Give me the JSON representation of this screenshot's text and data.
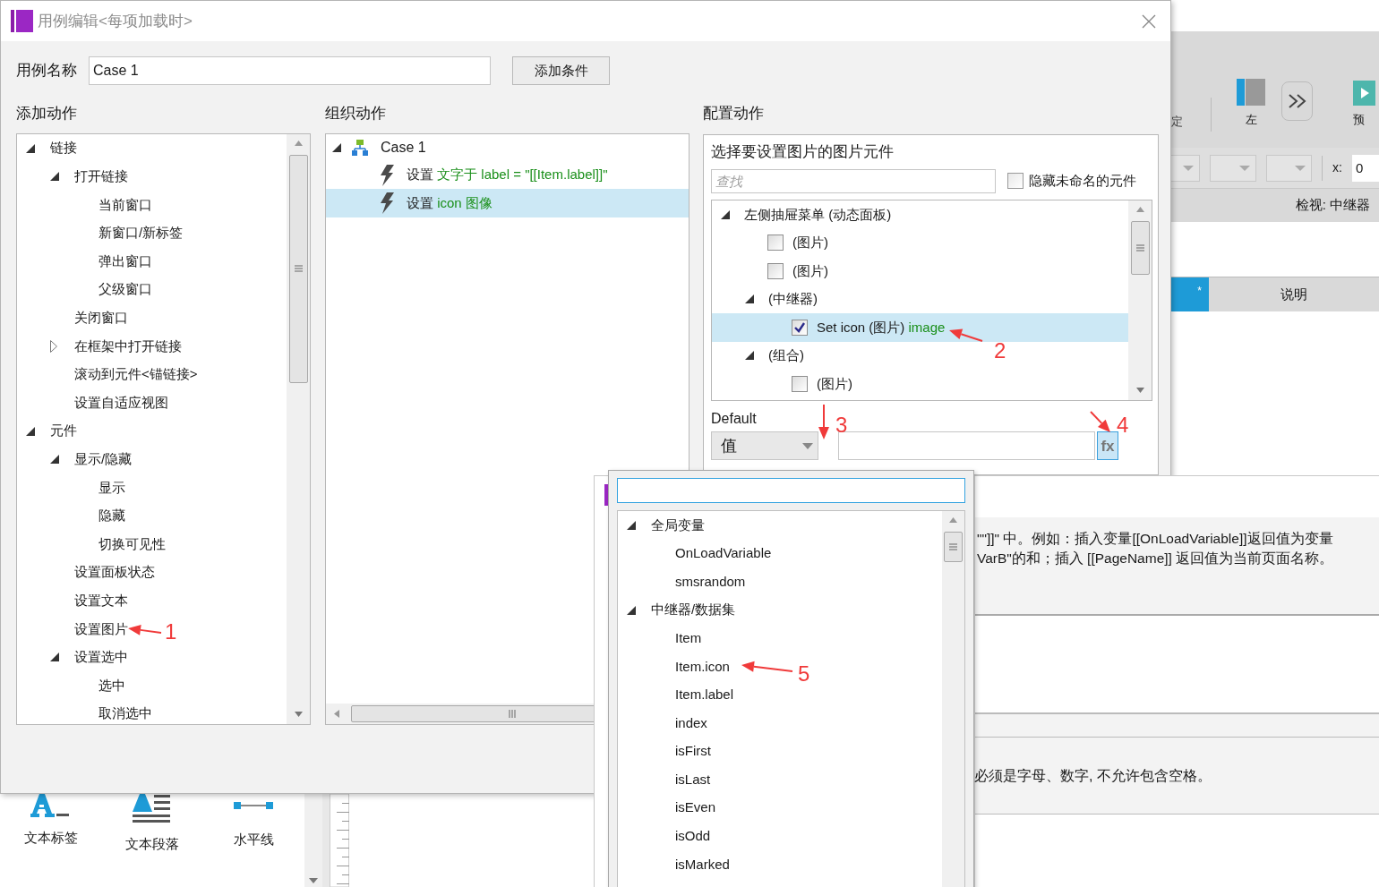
{
  "background": {
    "toolbar": {
      "items": [
        {
          "kind": "cut",
          "label": "定"
        },
        {
          "kind": "panel-left",
          "label": "左"
        },
        {
          "kind": "more"
        },
        {
          "kind": "preview",
          "label": "预"
        }
      ],
      "x_label": "x:",
      "x_value": "0"
    },
    "inspect_title": "检视: 中继器",
    "tabs": [
      {
        "label": "*",
        "selected": true
      },
      {
        "label": "说明",
        "selected": false
      }
    ],
    "help_lines": [
      "\"\"]]\" 中。例如：插入变量[[OnLoadVariable]]返回值为变量",
      "VarB\"的和；插入 [[PageName]] 返回值为当前页面名称。"
    ],
    "rule_text": "必须是字母、数字, 不允许包含空格。",
    "widgets": [
      {
        "kind": "label",
        "label": "文本标签"
      },
      {
        "kind": "paragraph",
        "label": "文本段落"
      },
      {
        "kind": "hline",
        "label": "水平线"
      }
    ]
  },
  "dialog": {
    "title": "用例编辑<每项加载时>",
    "case_name_label": "用例名称",
    "case_name": "Case 1",
    "add_condition_button": "添加条件"
  },
  "add_actions": {
    "heading": "添加动作",
    "tree": [
      {
        "label": "链接",
        "expanded": true,
        "children": [
          {
            "label": "打开链接",
            "expanded": true,
            "children": [
              {
                "label": "当前窗口"
              },
              {
                "label": "新窗口/新标签"
              },
              {
                "label": "弹出窗口"
              },
              {
                "label": "父级窗口"
              }
            ]
          },
          {
            "label": "关闭窗口"
          },
          {
            "label": "在框架中打开链接",
            "expanded": false
          },
          {
            "label": "滚动到元件<锚链接>"
          },
          {
            "label": "设置自适应视图"
          }
        ]
      },
      {
        "label": "元件",
        "expanded": true,
        "children": [
          {
            "label": "显示/隐藏",
            "expanded": true,
            "children": [
              {
                "label": "显示"
              },
              {
                "label": "隐藏"
              },
              {
                "label": "切换可见性"
              }
            ]
          },
          {
            "label": "设置面板状态"
          },
          {
            "label": "设置文本"
          },
          {
            "label": "设置图片"
          },
          {
            "label": "设置选中",
            "expanded": true,
            "children": [
              {
                "label": "选中"
              },
              {
                "label": "取消选中"
              }
            ]
          }
        ]
      }
    ]
  },
  "organize_actions": {
    "heading": "组织动作",
    "case": {
      "label": "Case 1",
      "expanded": true,
      "actions": [
        {
          "verb": "设置",
          "detail": "文字于 label = \"[[Item.label]]\"",
          "selected": false
        },
        {
          "verb": "设置",
          "detail": "icon 图像",
          "selected": true
        }
      ]
    }
  },
  "configure_action": {
    "heading": "配置动作",
    "prompt": "选择要设置图片的图片元件",
    "search": {
      "placeholder": "查找"
    },
    "hide_unnamed": {
      "label": "隐藏未命名的元件",
      "checked": false
    },
    "tree": [
      {
        "label": "左侧抽屉菜单 (动态面板)",
        "expanded": true,
        "children": [
          {
            "label": "(图片)",
            "checked": false,
            "selected": false
          },
          {
            "label": "(图片)",
            "checked": false,
            "selected": false
          },
          {
            "label": "(中继器)",
            "expanded": true,
            "children": [
              {
                "label": "Set icon (图片)",
                "value": "image",
                "checked": true,
                "selected": true
              }
            ]
          },
          {
            "label": "(组合)",
            "expanded": true,
            "children": [
              {
                "label": "(图片)",
                "checked": false,
                "selected": false
              }
            ]
          }
        ]
      }
    ],
    "default_label": "Default",
    "value_type": "值",
    "fx_button": "fx"
  },
  "variable_popup": {
    "tree": [
      {
        "label": "全局变量",
        "expanded": true,
        "children": [
          {
            "label": "OnLoadVariable"
          },
          {
            "label": "smsrandom"
          }
        ]
      },
      {
        "label": "中继器/数据集",
        "expanded": true,
        "children": [
          {
            "label": "Item"
          },
          {
            "label": "Item.icon"
          },
          {
            "label": "Item.label"
          },
          {
            "label": "index"
          },
          {
            "label": "isFirst"
          },
          {
            "label": "isLast"
          },
          {
            "label": "isEven"
          },
          {
            "label": "isOdd"
          },
          {
            "label": "isMarked"
          }
        ]
      }
    ]
  },
  "annotations": [
    {
      "label": "1"
    },
    {
      "label": "2"
    },
    {
      "label": "3"
    },
    {
      "label": "4"
    },
    {
      "label": "5"
    }
  ]
}
